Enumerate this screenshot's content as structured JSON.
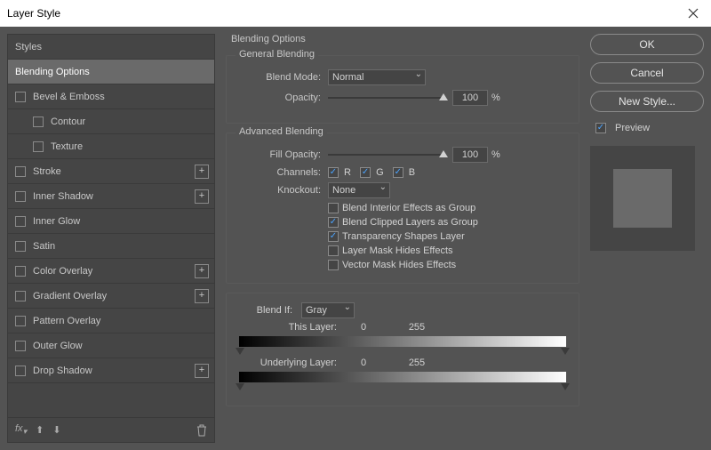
{
  "window": {
    "title": "Layer Style"
  },
  "sidebar": {
    "items": [
      {
        "label": "Styles",
        "type": "header"
      },
      {
        "label": "Blending Options",
        "type": "active"
      },
      {
        "label": "Bevel & Emboss",
        "chk": true
      },
      {
        "label": "Contour",
        "chk": true,
        "indent": true
      },
      {
        "label": "Texture",
        "chk": true,
        "indent": true
      },
      {
        "label": "Stroke",
        "chk": true,
        "plus": true
      },
      {
        "label": "Inner Shadow",
        "chk": true,
        "plus": true
      },
      {
        "label": "Inner Glow",
        "chk": true
      },
      {
        "label": "Satin",
        "chk": true
      },
      {
        "label": "Color Overlay",
        "chk": true,
        "plus": true
      },
      {
        "label": "Gradient Overlay",
        "chk": true,
        "plus": true
      },
      {
        "label": "Pattern Overlay",
        "chk": true
      },
      {
        "label": "Outer Glow",
        "chk": true
      },
      {
        "label": "Drop Shadow",
        "chk": true,
        "plus": true
      }
    ]
  },
  "center": {
    "title": "Blending Options",
    "general": {
      "title": "General Blending",
      "blend_mode_label": "Blend Mode:",
      "blend_mode_value": "Normal",
      "opacity_label": "Opacity:",
      "opacity_value": "100",
      "opacity_unit": "%"
    },
    "advanced": {
      "title": "Advanced Blending",
      "fill_label": "Fill Opacity:",
      "fill_value": "100",
      "fill_unit": "%",
      "channels_label": "Channels:",
      "ch_r": "R",
      "ch_g": "G",
      "ch_b": "B",
      "knockout_label": "Knockout:",
      "knockout_value": "None",
      "options": [
        {
          "label": "Blend Interior Effects as Group",
          "checked": false
        },
        {
          "label": "Blend Clipped Layers as Group",
          "checked": true
        },
        {
          "label": "Transparency Shapes Layer",
          "checked": true
        },
        {
          "label": "Layer Mask Hides Effects",
          "checked": false
        },
        {
          "label": "Vector Mask Hides Effects",
          "checked": false
        }
      ]
    },
    "blendif": {
      "label": "Blend If:",
      "value": "Gray",
      "this_label": "This Layer:",
      "this_lo": "0",
      "this_hi": "255",
      "under_label": "Underlying Layer:",
      "under_lo": "0",
      "under_hi": "255"
    }
  },
  "right": {
    "ok": "OK",
    "cancel": "Cancel",
    "new_style": "New Style...",
    "preview_label": "Preview"
  }
}
